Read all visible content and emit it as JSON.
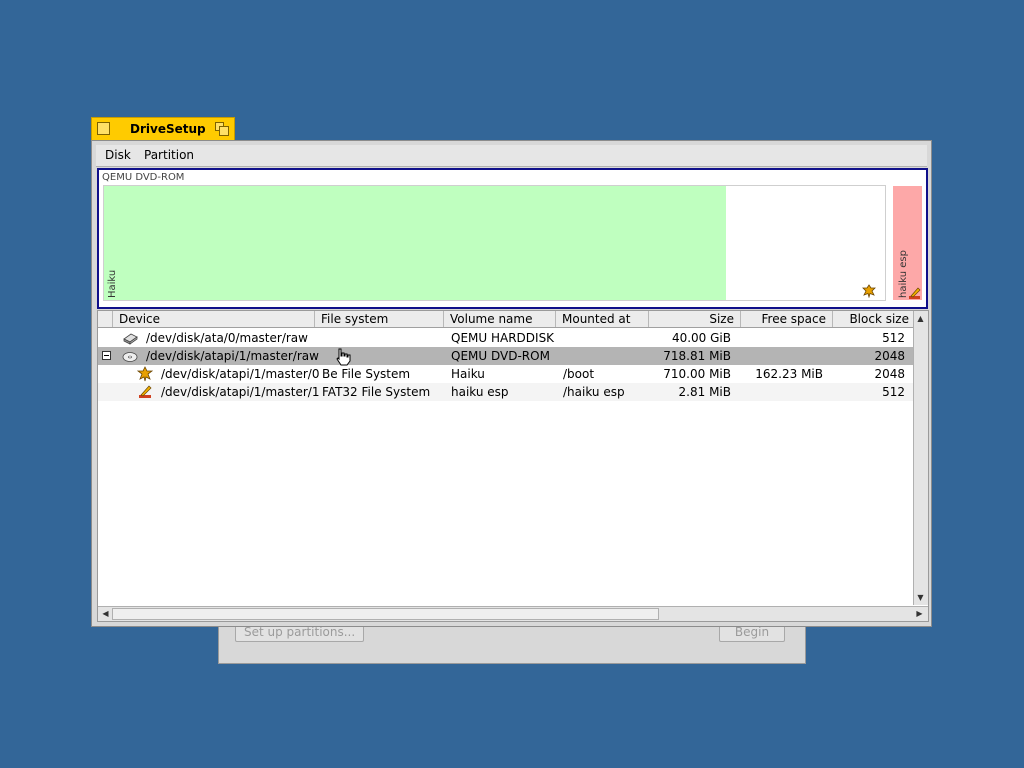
{
  "background_window": {
    "setup_button": "Set up partitions...",
    "begin_button": "Begin"
  },
  "window": {
    "title": "DriveSetup",
    "menus": [
      "Disk",
      "Partition"
    ]
  },
  "disk_map": {
    "disk_name": "QEMU DVD-ROM",
    "partitions": [
      {
        "label": "Haiku",
        "color": "#bfffbf"
      },
      {
        "label": "haiku esp",
        "color": "#fda8a8"
      }
    ]
  },
  "table": {
    "columns": [
      "Device",
      "File system",
      "Volume name",
      "Mounted at",
      "Size",
      "Free space",
      "Block size"
    ],
    "rows": [
      {
        "device": "/dev/disk/ata/0/master/raw",
        "fs": "",
        "volume": "QEMU HARDDISK",
        "mount": "",
        "size": "40.00 GiB",
        "free": "",
        "block": "512",
        "icon": "harddisk-icon"
      },
      {
        "device": "/dev/disk/atapi/1/master/raw",
        "fs": "",
        "volume": "QEMU DVD-ROM",
        "mount": "",
        "size": "718.81 MiB",
        "free": "",
        "block": "2048",
        "icon": "cdrom-icon"
      },
      {
        "device": "/dev/disk/atapi/1/master/0",
        "fs": "Be File System",
        "volume": "Haiku",
        "mount": "/boot",
        "size": "710.00 MiB",
        "free": "162.23 MiB",
        "block": "2048",
        "icon": "bfs-leaf-icon"
      },
      {
        "device": "/dev/disk/atapi/1/master/1",
        "fs": "FAT32 File System",
        "volume": "haiku esp",
        "mount": "/haiku esp",
        "size": "2.81 MiB",
        "free": "",
        "block": "512",
        "icon": "fat-pencil-icon"
      }
    ]
  },
  "colors": {
    "desktop": "#336698",
    "tab": "#ffcb00",
    "selection": "#b4b4b4",
    "disk_frame": "#10108a"
  }
}
